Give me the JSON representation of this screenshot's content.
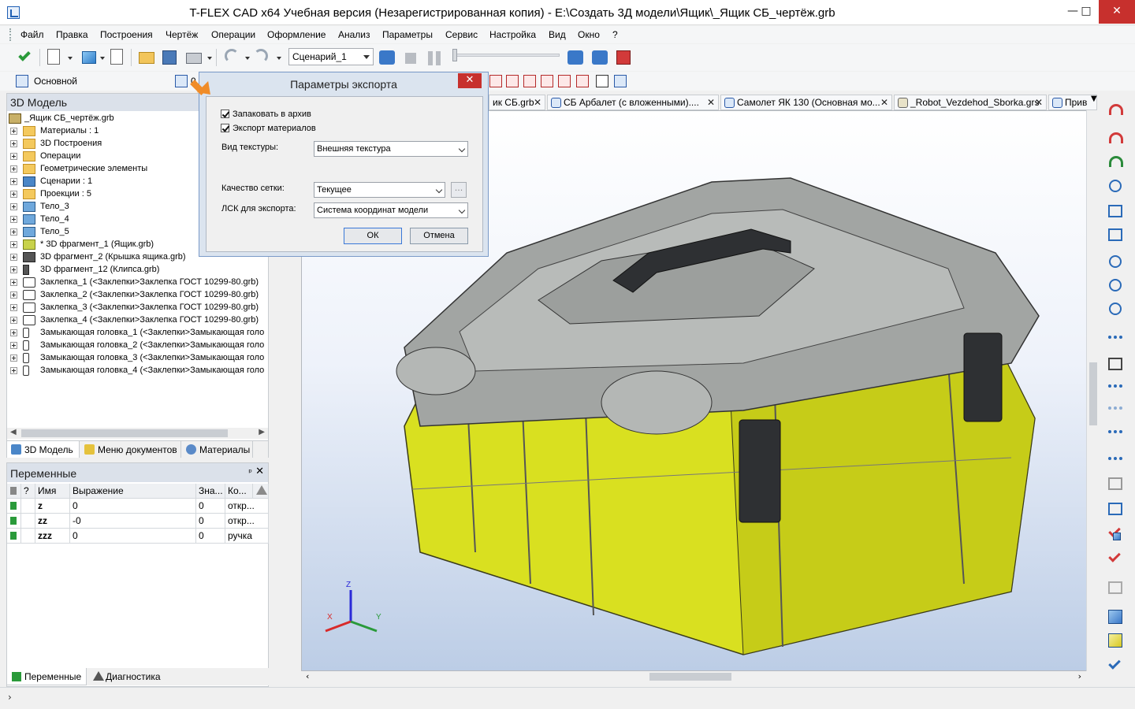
{
  "window": {
    "title": "T-FLEX CAD x64 Учебная версия (Незарегистрированная копия) - E:\\Создать 3Д модели\\Ящик\\_Ящик СБ_чертёж.grb",
    "min": "—",
    "max": "□",
    "close": "✕"
  },
  "menu": [
    "Файл",
    "Правка",
    "Построения",
    "Чертёж",
    "Операции",
    "Оформление",
    "Анализ",
    "Параметры",
    "Сервис",
    "Настройка",
    "Вид",
    "Окно",
    "?"
  ],
  "toolbar": {
    "scenario": "Сценарий_1"
  },
  "toolbar2": {
    "main_label": "Основной",
    "value": "0"
  },
  "model_panel": {
    "title": "3D Модель",
    "root": "_Ящик СБ_чертёж.grb",
    "items": [
      {
        "label": "Материалы : 1",
        "icon": "folder"
      },
      {
        "label": "3D Построения",
        "icon": "folder"
      },
      {
        "label": "Операции",
        "icon": "folder"
      },
      {
        "label": "Геометрические элементы",
        "icon": "folder"
      },
      {
        "label": "Сценарии : 1",
        "icon": "scenario"
      },
      {
        "label": "Проекции : 5",
        "icon": "folder"
      },
      {
        "label": "Тело_3",
        "icon": "body"
      },
      {
        "label": "Тело_4",
        "icon": "body"
      },
      {
        "label": "Тело_5",
        "icon": "body"
      },
      {
        "label": "* 3D фрагмент_1 (Ящик.grb)",
        "icon": "fragment"
      },
      {
        "label": "3D фрагмент_2 (Крышка ящика.grb)",
        "icon": "fragment-dark"
      },
      {
        "label": "3D фрагмент_12 (Клипса.grb)",
        "icon": "fragment-dark"
      },
      {
        "label": "Заклепка_1 (<Заклепки>Заклепка ГОСТ 10299-80.grb)",
        "icon": "rivet"
      },
      {
        "label": "Заклепка_2 (<Заклепки>Заклепка ГОСТ 10299-80.grb)",
        "icon": "rivet"
      },
      {
        "label": "Заклепка_3 (<Заклепки>Заклепка ГОСТ 10299-80.grb)",
        "icon": "rivet"
      },
      {
        "label": "Заклепка_4 (<Заклепки>Заклепка ГОСТ 10299-80.grb)",
        "icon": "rivet"
      },
      {
        "label": "Замыкающая головка_1 (<Заклепки>Замыкающая голо",
        "icon": "rivet"
      },
      {
        "label": "Замыкающая головка_2 (<Заклепки>Замыкающая голо",
        "icon": "rivet"
      },
      {
        "label": "Замыкающая головка_3 (<Заклепки>Замыкающая голо",
        "icon": "rivet"
      },
      {
        "label": "Замыкающая головка_4 (<Заклепки>Замыкающая голо",
        "icon": "rivet"
      }
    ],
    "tabs": [
      "3D Модель",
      "Меню документов",
      "Материалы"
    ]
  },
  "vars_panel": {
    "title": "Переменные",
    "pin": "ᵖ",
    "close": "✕",
    "columns": [
      "?",
      "Имя",
      "Выражение",
      "Зна...",
      "Ко..."
    ],
    "rows": [
      {
        "name": "z",
        "expr": "0",
        "value": "0",
        "comment": "откр..."
      },
      {
        "name": "zz",
        "expr": "-0",
        "value": "0",
        "comment": "откр..."
      },
      {
        "name": "zzz",
        "expr": "0",
        "value": "0",
        "comment": "ручка"
      }
    ],
    "bottom_tabs": [
      "Переменные",
      "Диагностика"
    ]
  },
  "doc_tabs": [
    "ик СБ.grb",
    "СБ Арбалет (с вложенными)....",
    "Самолет ЯК 130 (Основная мо...",
    "_Robot_Vezdehod_Sborka.grs",
    "Прив"
  ],
  "dialog": {
    "title": "Параметры экспорта",
    "close": "✕",
    "check_archive": "Запаковать в архив",
    "check_materials": "Экспорт материалов",
    "texture_label": "Вид текстуры:",
    "texture_value": "Внешняя текстура",
    "mesh_label": "Качество сетки:",
    "mesh_value": "Текущее",
    "lcs_label": "ЛСК для экспорта:",
    "lcs_value": "Система координат модели",
    "dots": "...",
    "ok": "ОК",
    "cancel": "Отмена"
  },
  "axes": {
    "x": "X",
    "y": "Y",
    "z": "Z"
  },
  "colors": {
    "case_yellow": "#d9e020",
    "lid_grey": "#a2a5a3",
    "accent_orange": "#f08c28",
    "close_red": "#c7302d"
  }
}
